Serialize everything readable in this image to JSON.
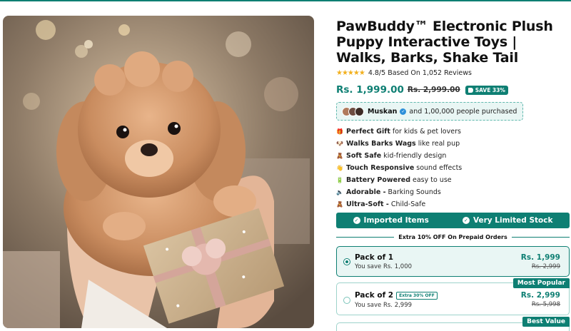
{
  "product": {
    "title": "PawBuddy™ Electronic Plush Puppy Interactive Toys | Walks, Barks, Shake Tail",
    "stars": "★★★★★",
    "rating_text": "4.8/5 Based On 1,052 Reviews",
    "price": "Rs. 1,999.00",
    "compare_price": "Rs. 2,999.00",
    "save_badge": "SAVE 33%"
  },
  "social_proof": {
    "name": "Muskan",
    "text": "and 1,00,000 people purchased"
  },
  "features": [
    {
      "icon": "🎁",
      "icon_name": "gift-icon",
      "bold": "Perfect Gift",
      "text": "for kids & pet lovers"
    },
    {
      "icon": "🐶",
      "icon_name": "dog-icon",
      "bold": "Walks Barks Wags",
      "text": "like real pup"
    },
    {
      "icon": "🧸",
      "icon_name": "teddy-bear-icon",
      "bold": "Soft Safe",
      "text": "kid-friendly design"
    },
    {
      "icon": "👋",
      "icon_name": "hand-wave-icon",
      "bold": "Touch Responsive",
      "text": "sound effects"
    },
    {
      "icon": "🔋",
      "icon_name": "battery-icon",
      "bold": "Battery Powered",
      "text": "easy to use"
    },
    {
      "icon": "🔈",
      "icon_name": "speaker-icon",
      "bold": "Adorable -",
      "text": "Barking Sounds"
    },
    {
      "icon": "🧸",
      "icon_name": "teddy-bear-icon",
      "bold": "Ultra-Soft -",
      "text": "Child-Safe"
    }
  ],
  "trust_bar": {
    "left": "Imported Items",
    "right": "Very Limited Stock"
  },
  "offer_divider": "Extra 10% OFF On Prepaid Orders",
  "packs": [
    {
      "title": "Pack of 1",
      "subtitle": "You save Rs. 1,000",
      "price": "Rs. 1,999",
      "compare": "Rs. 2,999",
      "selected": true
    },
    {
      "title": "Pack of 2",
      "badge": "Extra 30% OFF",
      "subtitle": "You save Rs. 2,999",
      "price": "Rs. 2,999",
      "compare": "Rs. 5,998",
      "ribbon": "Most Popular",
      "selected": false
    },
    {
      "ribbon": "Best Value",
      "selected": false
    }
  ],
  "colors": {
    "brand": "#0e7f73",
    "star": "#f2b01e",
    "verified": "#2d8fd9"
  }
}
